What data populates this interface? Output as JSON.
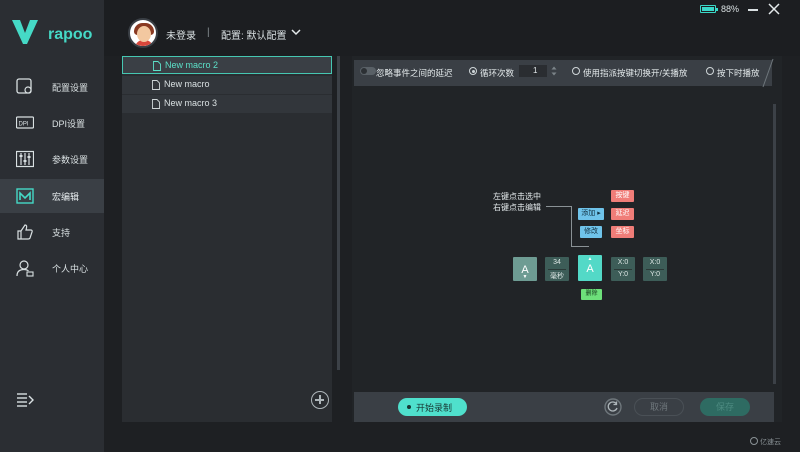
{
  "header": {
    "login_status": "未登录",
    "separator": "|",
    "config_label": "配置: 默认配置",
    "battery_percent": "88%",
    "battery_level": 0.88
  },
  "sidebar": {
    "brand": "rapoo",
    "items": [
      {
        "label": "配置设置",
        "icon": "config-icon"
      },
      {
        "label": "DPI设置",
        "icon": "dpi-icon"
      },
      {
        "label": "参数设置",
        "icon": "sliders-icon"
      },
      {
        "label": "宏编辑",
        "icon": "macro-icon",
        "active": true
      },
      {
        "label": "支持",
        "icon": "thumbs-up-icon"
      },
      {
        "label": "个人中心",
        "icon": "user-icon"
      }
    ]
  },
  "macros": {
    "items": [
      "New macro 2",
      "New macro",
      "New macro 3"
    ],
    "selected": 0
  },
  "toolbar": {
    "ignore_delay_label": "忽略事件之间的延迟",
    "loop_label": "循环次数",
    "loop_value": "1",
    "toggle_mode_label": "使用指派按键切换开/关播放",
    "press_play_label": "按下时播放"
  },
  "canvas": {
    "hint_line1": "左键点击选中",
    "hint_line2": "右键点击编辑",
    "add_label": "添加",
    "edit_label": "修改",
    "key_label": "按键",
    "delay_label": "延迟",
    "coord_label": "坐标",
    "delete_label": "删除",
    "key_glyph": "A",
    "delay_value": "34",
    "delay_unit": "毫秒",
    "coord1_x": "X:0",
    "coord1_y": "Y:0",
    "coord2_x": "X:0",
    "coord2_y": "Y:0"
  },
  "bottom": {
    "record_label": "开始录制",
    "cancel_label": "取消",
    "save_label": "保存"
  },
  "watermark": "亿速云",
  "colors": {
    "accent": "#4fe0cc",
    "sidebar_bg": "#2b2e33",
    "panel_bg": "#2a2d31",
    "delete_green": "#6de07a",
    "action_blue": "#6fc3ea",
    "action_red": "#f07d78"
  }
}
